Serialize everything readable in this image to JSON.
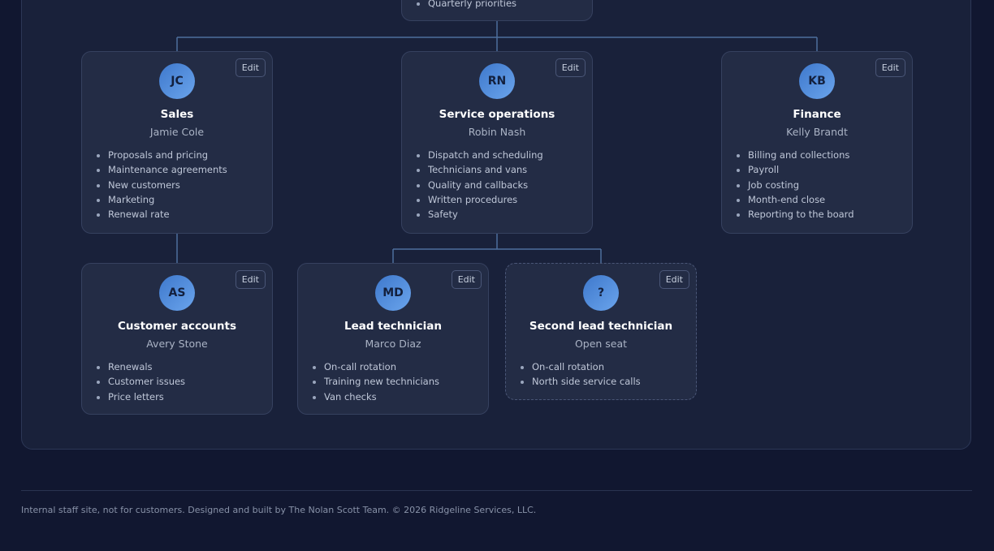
{
  "top_card": {
    "duties": [
      "Quarterly priorities"
    ]
  },
  "cards": {
    "sales": {
      "initials": "JC",
      "title": "Sales",
      "person": "Jamie Cole",
      "edit": "Edit",
      "duties": [
        "Proposals and pricing",
        "Maintenance agreements",
        "New customers",
        "Marketing",
        "Renewal rate"
      ]
    },
    "service": {
      "initials": "RN",
      "title": "Service operations",
      "person": "Robin Nash",
      "edit": "Edit",
      "duties": [
        "Dispatch and scheduling",
        "Technicians and vans",
        "Quality and callbacks",
        "Written procedures",
        "Safety"
      ]
    },
    "finance": {
      "initials": "KB",
      "title": "Finance",
      "person": "Kelly Brandt",
      "edit": "Edit",
      "duties": [
        "Billing and collections",
        "Payroll",
        "Job costing",
        "Month-end close",
        "Reporting to the board"
      ]
    },
    "accounts": {
      "initials": "AS",
      "title": "Customer accounts",
      "person": "Avery Stone",
      "edit": "Edit",
      "duties": [
        "Renewals",
        "Customer issues",
        "Price letters"
      ]
    },
    "lead": {
      "initials": "MD",
      "title": "Lead technician",
      "person": "Marco Diaz",
      "edit": "Edit",
      "duties": [
        "On-call rotation",
        "Training new technicians",
        "Van checks"
      ]
    },
    "second": {
      "initials": "?",
      "title": "Second lead technician",
      "person": "Open seat",
      "edit": "Edit",
      "duties": [
        "On-call rotation",
        "North side service calls"
      ]
    }
  },
  "footer": {
    "text": "Internal staff site, not for customers. Designed and built by The Nolan Scott Team. © 2026 Ridgeline Services, LLC."
  },
  "colors": {
    "connector": "#4d6f9c",
    "avatar_gradient_start": "#3e78cc",
    "avatar_gradient_end": "#6aa4ec"
  }
}
